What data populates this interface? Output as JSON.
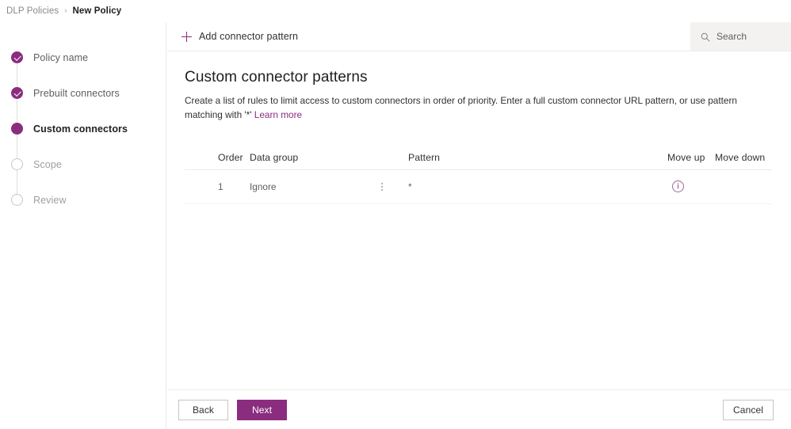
{
  "breadcrumb": {
    "root": "DLP Policies",
    "separator": "›",
    "current": "New Policy"
  },
  "wizard": {
    "steps": [
      {
        "label": "Policy name",
        "state": "done"
      },
      {
        "label": "Prebuilt connectors",
        "state": "done"
      },
      {
        "label": "Custom connectors",
        "state": "current"
      },
      {
        "label": "Scope",
        "state": "todo"
      },
      {
        "label": "Review",
        "state": "todo"
      }
    ]
  },
  "commandbar": {
    "add_label": "Add connector pattern",
    "add_icon": "plus-icon",
    "search": {
      "placeholder": "Search",
      "value": "",
      "icon": "search-icon"
    }
  },
  "content": {
    "title": "Custom connector patterns",
    "description": "Create a list of rules to limit access to custom connectors in order of priority. Enter a full custom connector URL pattern, or use pattern matching with '*'",
    "learn_more": "Learn more"
  },
  "table": {
    "columns": [
      "Order",
      "Data group",
      "Pattern",
      "Move up",
      "Move down"
    ],
    "rows": [
      {
        "order": "1",
        "data_group": "Ignore",
        "group_menu_icon": "kebab-menu-icon",
        "pattern": "*",
        "move_up_icon": "info-icon",
        "move_up_glyph": "i",
        "move_down": ""
      }
    ]
  },
  "footer": {
    "back_label": "Back",
    "next_label": "Next",
    "cancel_label": "Cancel"
  },
  "colors": {
    "accent": "#8a2d7f",
    "text": "#323130",
    "muted": "#605e5c",
    "disabled": "#a19f9d",
    "divider": "#edebe9",
    "search_bg": "#f3f2f1"
  }
}
